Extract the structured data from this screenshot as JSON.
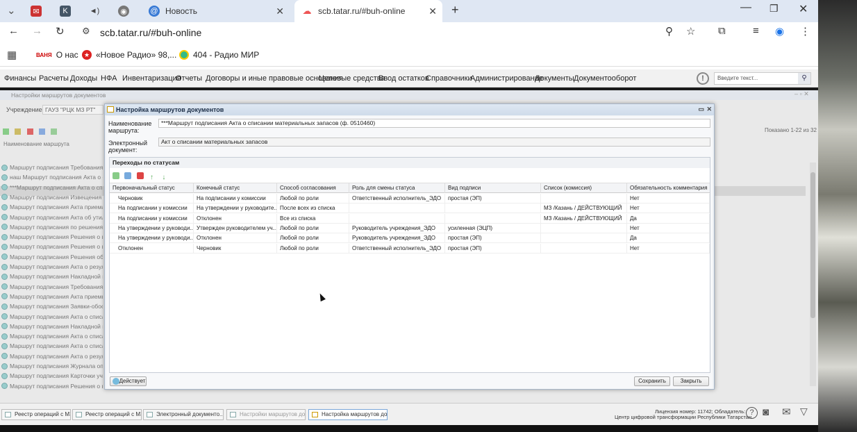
{
  "browser": {
    "tabs": [
      {
        "label": ""
      },
      {
        "label": ""
      },
      {
        "label": ""
      },
      {
        "label": ""
      },
      {
        "label": ""
      },
      {
        "label": "Новость"
      },
      {
        "label": "scb.tatar.ru/#buh-online"
      }
    ],
    "url": "scb.tatar.ru/#buh-online",
    "bookmarks": [
      {
        "label": "О нас",
        "badge": "ВАНЯ"
      },
      {
        "label": "«Новое Радио» 98,..."
      },
      {
        "label": "404 - Радио МИР"
      }
    ]
  },
  "app_menu": {
    "items": [
      "Финансы",
      "Расчеты",
      "Доходы",
      "НФА",
      "Инвентаризация",
      "Отчеты",
      "Договоры и иные правовые основания",
      "Целевые средства",
      "Ввод остатков",
      "Справочники",
      "Администрирование",
      "Документы",
      "Документооборот"
    ],
    "search_placeholder": "Введите текст..."
  },
  "background": {
    "panel_title": "Настройки маршрутов документов",
    "institution_label": "Учреждение:",
    "institution_value": "ГАУЗ \"РЦК МЗ РТ\"",
    "column_header": "Наименование маршрута",
    "shown": "Показано 1-22 из 32",
    "rows": [
      "Маршрут подписания Требования-накладной",
      "наш Маршрут подписания Акта о списании",
      "***Маршрут подписания Акта о списании",
      "Маршрут подписания Извещения о начислении",
      "Маршрут подписания Акта приема-передачи",
      "Маршрут подписания Акта об утилизации",
      "Маршрут подписания по решениям о",
      "Маршрут подписания Решения о прекращении",
      "Маршрут подписания Решения о признании",
      "Маршрут подписания Решения об отнесении",
      "Маршрут подписания Акта о результатах",
      "Маршрут подписания Накладной на внутреннее",
      "Маршрут подписания Требования-накладной",
      "Маршрут подписания Акта приемки товаров",
      "Маршрут подписания Заявки-обоснования",
      "Маршрут подписания Акта о списании",
      "Маршрут подписания Накладной на отпуск",
      "Маршрут подписания Акта о списании",
      "Маршрут подписания Акта о списании",
      "Маршрут подписания Акта о результатах",
      "Маршрут подписания Журнала операций",
      "Маршрут подписания Карточки учета",
      "Маршрут подписания Решения о проведении"
    ]
  },
  "modal": {
    "title": "Настройка маршрутов документов",
    "name_label": "Наименование маршрута:",
    "name_value": "***Маршрут подписания Акта о списании материальных запасов (ф. 0510460)",
    "doc_label": "Электронный документ:",
    "doc_value": "Акт о списании материальных запасов",
    "grid_title": "Переходы по статусам",
    "columns": [
      "Первоначальный статус",
      "Конечный статус",
      "Способ согласования",
      "Роль для смены статуса",
      "Вид подписи",
      "Список (комиссия)",
      "Обязательность комментария"
    ],
    "rows": [
      [
        "Черновик",
        "На подписании у комиссии",
        "Любой по роли",
        "Ответственный исполнитель_ЭДО",
        "простая (ЭП)",
        "",
        "Нет"
      ],
      [
        "На подписании у комиссии",
        "На утверждении у руководите...",
        "После всех из списка",
        "",
        "",
        "МЗ /Казань / ДЕЙСТВУЮЩИЙ",
        "Нет"
      ],
      [
        "На подписании у комиссии",
        "Отклонен",
        "Все из списка",
        "",
        "",
        "МЗ /Казань / ДЕЙСТВУЮЩИЙ",
        "Да"
      ],
      [
        "На утверждении у руководи...",
        "Утвержден руководителем уч...",
        "Любой по роли",
        "Руководитель учреждения_ЭДО",
        "усиленная (ЭЦП)",
        "",
        "Нет"
      ],
      [
        "На утверждении у руководи...",
        "Отклонен",
        "Любой по роли",
        "Руководитель учреждения_ЭДО",
        "простая (ЭП)",
        "",
        "Да"
      ],
      [
        "Отклонен",
        "Черновик",
        "Любой по роли",
        "Ответственный исполнитель_ЭДО",
        "простая (ЭП)",
        "",
        "Нет"
      ]
    ],
    "status_button": "Действует",
    "save_button": "Сохранить",
    "close_button": "Закрыть"
  },
  "taskbar": {
    "tasks": [
      "Реестр операций с МЗ",
      "Реестр операций с МЗ",
      "Электронный документо...",
      "Настройки маршрутов до...",
      "Настройка маршрутов до..."
    ],
    "license": "Лицензия номер: 11742; Обладатель:",
    "owner": "Центр цифровой трансформации Республики Татарстан"
  },
  "colors": {
    "accent": "#1a73e8",
    "menu_bg": "#f1f1f1",
    "modal_title_bg": "#cfdbea"
  }
}
